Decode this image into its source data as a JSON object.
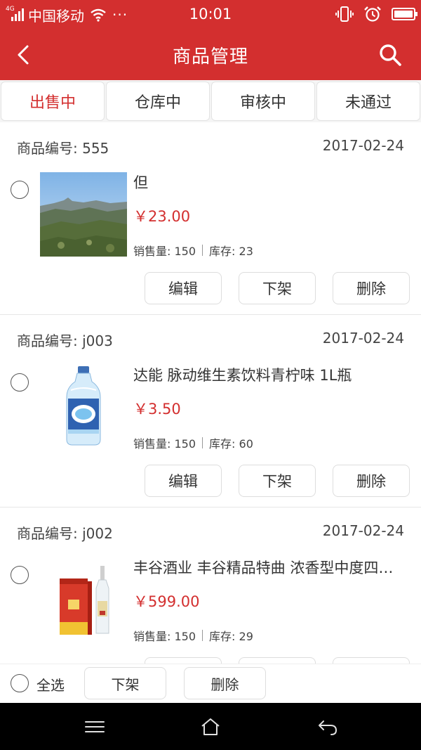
{
  "status_bar": {
    "network": "4G",
    "carrier": "中国移动",
    "more": "···",
    "time": "10:01"
  },
  "header": {
    "title": "商品管理"
  },
  "tabs": [
    {
      "label": "出售中",
      "active": true
    },
    {
      "label": "仓库中",
      "active": false
    },
    {
      "label": "审核中",
      "active": false
    },
    {
      "label": "未通过",
      "active": false
    }
  ],
  "labels": {
    "code_prefix": "商品编号: ",
    "sales_prefix": "销售量: ",
    "stock_prefix": "库存: ",
    "edit": "编辑",
    "take_down": "下架",
    "delete": "删除"
  },
  "products": [
    {
      "code": "商品编号: 555",
      "date": "2017-02-24",
      "name": "但",
      "price": "￥23.00",
      "sales": "销售量: 150",
      "stock": "库存: 23",
      "image": "landscape-photo"
    },
    {
      "code": "商品编号: j003",
      "date": "2017-02-24",
      "name": "达能 脉动维生素饮料青柠味 1L瓶",
      "price": "￥3.50",
      "sales": "销售量: 150",
      "stock": "库存: 60",
      "image": "water-bottle"
    },
    {
      "code": "商品编号: j002",
      "date": "2017-02-24",
      "name": "丰谷酒业 丰谷精品特曲 浓香型中度四…",
      "price": "￥599.00",
      "sales": "销售量: 150",
      "stock": "库存: 29",
      "image": "liquor-box"
    }
  ],
  "bottom_bar": {
    "select_all": "全选",
    "take_down": "下架",
    "delete": "删除"
  },
  "colors": {
    "brand": "#d32f2f",
    "price": "#d32f2f"
  }
}
